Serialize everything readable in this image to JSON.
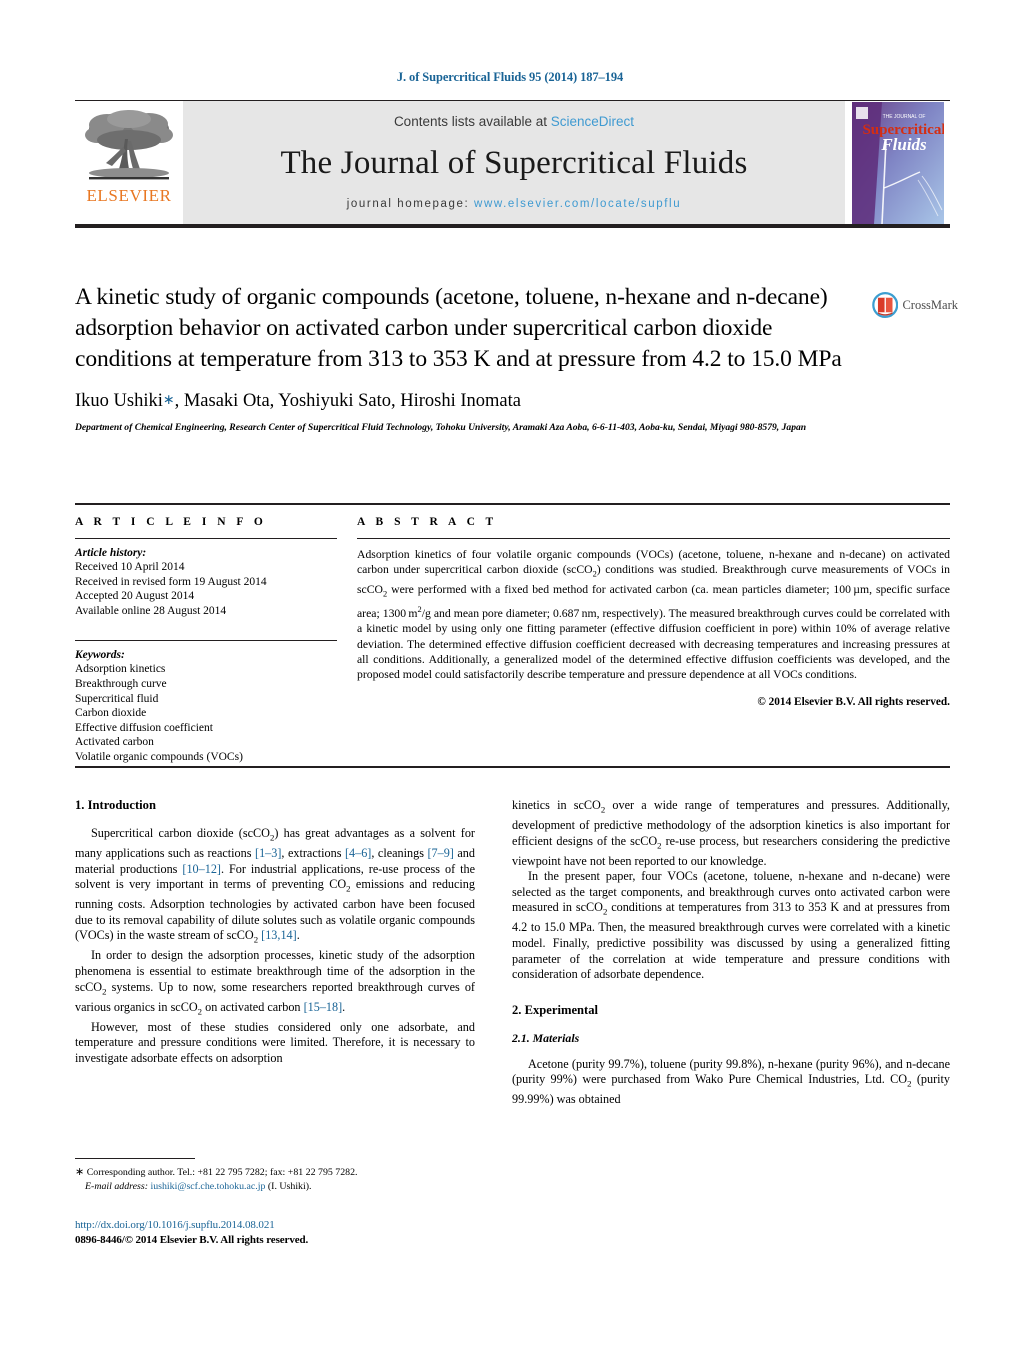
{
  "running_head": "J. of Supercritical Fluids 95 (2014) 187–194",
  "masthead": {
    "publisher_name": "ELSEVIER",
    "contents_prefix": "Contents lists available at ",
    "contents_link": "ScienceDirect",
    "journal_name": "The Journal of Supercritical Fluids",
    "homepage_prefix": "journal homepage: ",
    "homepage_url": "www.elsevier.com/locate/supflu",
    "cover": {
      "kicker": "THE JOURNAL OF",
      "line1": "Supercritical",
      "line2": "Fluids"
    }
  },
  "article": {
    "title": "A kinetic study of organic compounds (acetone, toluene, n-hexane and n-decane) adsorption behavior on activated carbon under supercritical carbon dioxide conditions at temperature from 313 to 353 K and at pressure from 4.2 to 15.0 MPa",
    "authors": "Ikuo Ushiki",
    "authors_rest": ", Masaki Ota, Yoshiyuki Sato, Hiroshi Inomata",
    "corresponding_marker": "∗",
    "affiliation": "Department of Chemical Engineering, Research Center of Supercritical Fluid Technology, Tohoku University, Aramaki Aza Aoba, 6-6-11-403, Aoba-ku, Sendai, Miyagi 980-8579, Japan",
    "crossmark_label": "CrossMark"
  },
  "info": {
    "heading": "A R T I C L E    I N F O",
    "history_label": "Article history:",
    "history": [
      "Received 10 April 2014",
      "Received in revised form 19 August 2014",
      "Accepted 20 August 2014",
      "Available online 28 August 2014"
    ],
    "keywords_label": "Keywords:",
    "keywords": [
      "Adsorption kinetics",
      "Breakthrough curve",
      "Supercritical fluid",
      "Carbon dioxide",
      "Effective diffusion coefficient",
      "Activated carbon",
      "Volatile organic compounds (VOCs)"
    ]
  },
  "abstract": {
    "heading": "A B S T R A C T",
    "copyright": "© 2014 Elsevier B.V. All rights reserved."
  },
  "body": {
    "intro_heading": "1.  Introduction",
    "experimental_heading": "2.  Experimental",
    "materials_heading": "2.1.  Materials"
  },
  "footer": {
    "corresponding_star": "∗",
    "corresponding_text": " Corresponding author. Tel.: +81 22 795 7282; fax: +81 22 795 7282.",
    "email_label": "E-mail address:",
    "email": "iushiki@scf.che.tohoku.ac.jp",
    "email_suffix": " (I. Ushiki).",
    "doi": "http://dx.doi.org/10.1016/j.supflu.2014.08.021",
    "issn": "0896-8446/© 2014 Elsevier B.V. All rights reserved."
  },
  "colors": {
    "link": "#1a6496",
    "sciencedirect": "#3f9ad1",
    "elsevier_orange": "#E87722",
    "masthead_bg": "#e6e6e6"
  }
}
